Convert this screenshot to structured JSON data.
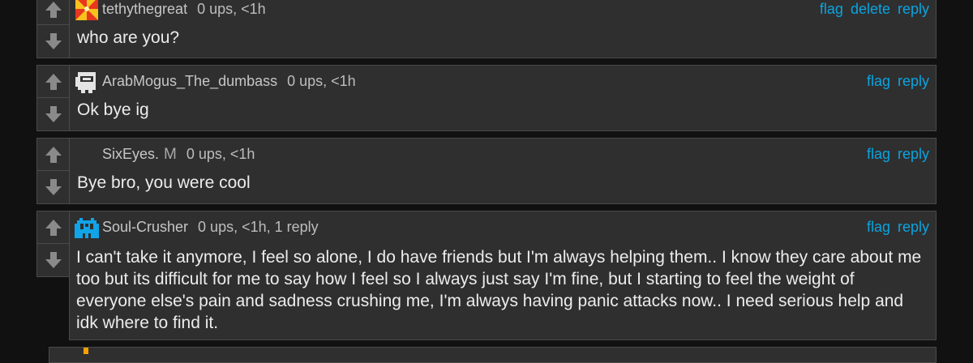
{
  "colors": {
    "background": "#111111",
    "card": "#2f2f2f",
    "border": "#4a4a4a",
    "link": "#0aa4e0"
  },
  "comments": [
    {
      "username": "tethythegreat",
      "stats": "0 ups, <1h",
      "actions": [
        "flag",
        "delete",
        "reply"
      ],
      "text": "who are you?",
      "avatar_icon": "pinwheel-avatar-icon"
    },
    {
      "username": "ArabMogus_The_dumbass",
      "stats": "0 ups, <1h",
      "actions": [
        "flag",
        "reply"
      ],
      "text": "Ok bye ig",
      "avatar_icon": "pixel-crewmate-avatar-icon"
    },
    {
      "username": "SixEyes.",
      "mod_badge": "M",
      "stats": "0 ups, <1h",
      "actions": [
        "flag",
        "reply"
      ],
      "text": "Bye bro, you were cool"
    },
    {
      "username": "Soul-Crusher",
      "stats": "0 ups, <1h, 1 reply",
      "actions": [
        "flag",
        "reply"
      ],
      "text": "I can't take it anymore, I feel so alone, I do have friends but I'm always helping them.. I know they care about me too but its difficult for me to say how I feel so I always just say I'm fine, but I starting to feel the weight of everyone else's pain and sadness crushing me, I'm always having panic attacks now.. I need serious help and idk where to find it.",
      "avatar_icon": "pixel-invader-avatar-icon"
    }
  ]
}
